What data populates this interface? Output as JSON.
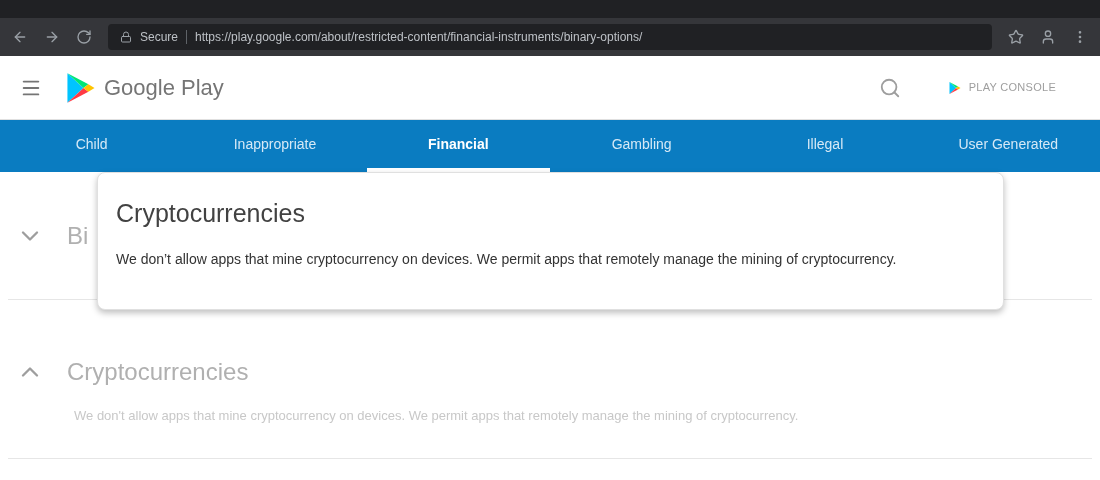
{
  "browser": {
    "security": "Secure",
    "url": "https://play.google.com/about/restricted-content/financial-instruments/binary-options/"
  },
  "header": {
    "logo_text": "Google Play",
    "console_link": "PLAY CONSOLE"
  },
  "tabs": [
    {
      "label": "Child",
      "selected": false
    },
    {
      "label": "Inappropriate",
      "selected": false
    },
    {
      "label": "Financial",
      "selected": true
    },
    {
      "label": "Gambling",
      "selected": false
    },
    {
      "label": "Illegal",
      "selected": false
    },
    {
      "label": "User Generated",
      "selected": false
    }
  ],
  "sections": [
    {
      "title": "Bi",
      "expanded": false
    },
    {
      "title": "Cryptocurrencies",
      "expanded": true,
      "body": "We don't allow apps that mine cryptocurrency on devices. We permit apps that remotely manage the mining of cryptocurrency."
    }
  ],
  "callout": {
    "title": "Cryptocurrencies",
    "body": "We don’t allow apps that mine cryptocurrency on devices. We permit apps that remotely manage the mining of cryptocurrency."
  }
}
